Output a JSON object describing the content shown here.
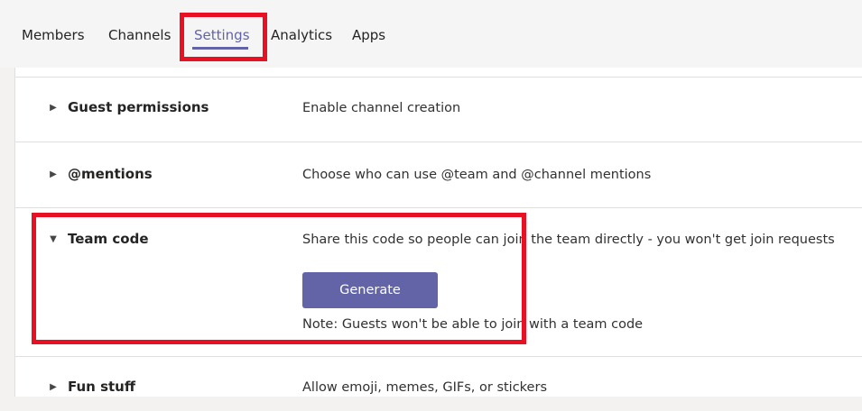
{
  "tabs": [
    {
      "label": "Members",
      "active": false
    },
    {
      "label": "Channels",
      "active": false
    },
    {
      "label": "Settings",
      "active": true
    },
    {
      "label": "Analytics",
      "active": false
    },
    {
      "label": "Apps",
      "active": false
    }
  ],
  "settings": {
    "rows": [
      {
        "title": "Guest permissions",
        "description": "Enable channel creation",
        "expanded": false
      },
      {
        "title": "@mentions",
        "description": "Choose who can use @team and @channel mentions",
        "expanded": false
      },
      {
        "title": "Team code",
        "description": "Share this code so people can join the team directly - you won't get join requests",
        "expanded": true,
        "button_label": "Generate",
        "note": "Note: Guests won't be able to join with a team code"
      },
      {
        "title": "Fun stuff",
        "description": "Allow emoji, memes, GIFs, or stickers",
        "expanded": false
      }
    ]
  },
  "icons": {
    "collapsed": "caret-right",
    "expanded": "caret-down"
  },
  "colors": {
    "accent": "#6264a7",
    "highlight": "#e81123",
    "background": "#f3f2f1",
    "panel": "#ffffff"
  }
}
